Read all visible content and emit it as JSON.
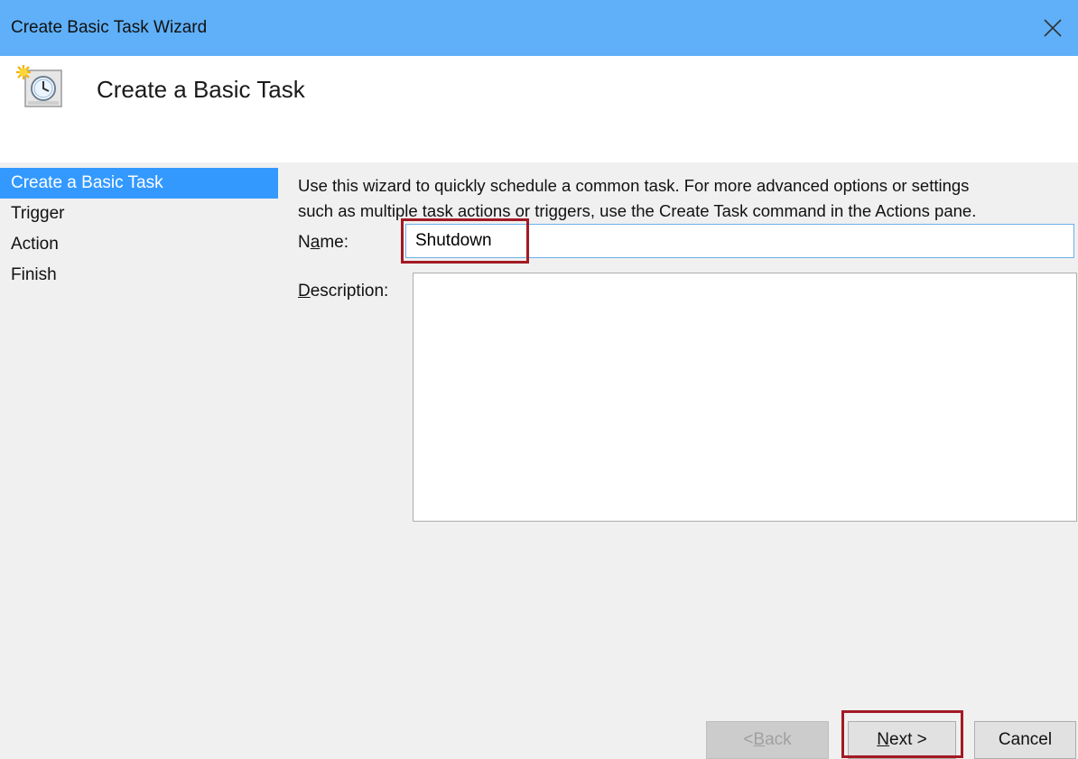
{
  "window": {
    "title": "Create Basic Task Wizard",
    "close_glyph": "✕"
  },
  "header": {
    "title": "Create a Basic Task",
    "icon": "task-scheduler-clock-icon"
  },
  "nav": {
    "items": [
      {
        "label": "Create a Basic Task",
        "active": true
      },
      {
        "label": "Trigger",
        "active": false
      },
      {
        "label": "Action",
        "active": false
      },
      {
        "label": "Finish",
        "active": false
      }
    ]
  },
  "main": {
    "intro_line1": "Use this wizard to quickly schedule a common task.  For more advanced options or settings",
    "intro_line2": "such as multiple task actions or triggers, use the Create Task command in the Actions pane.",
    "name_label_pre": "N",
    "name_label_accel": "a",
    "name_label_post": "me:",
    "name_value": "Shutdown",
    "description_label_accel": "D",
    "description_label_post": "escription:",
    "description_value": ""
  },
  "buttons": {
    "back_pre": "< ",
    "back_accel": "B",
    "back_post": "ack",
    "next_accel": "N",
    "next_post": "ext >",
    "cancel": "Cancel"
  },
  "colors": {
    "titlebar": "#5fb0f8",
    "nav_active": "#3399ff",
    "highlight": "#a31a24"
  }
}
